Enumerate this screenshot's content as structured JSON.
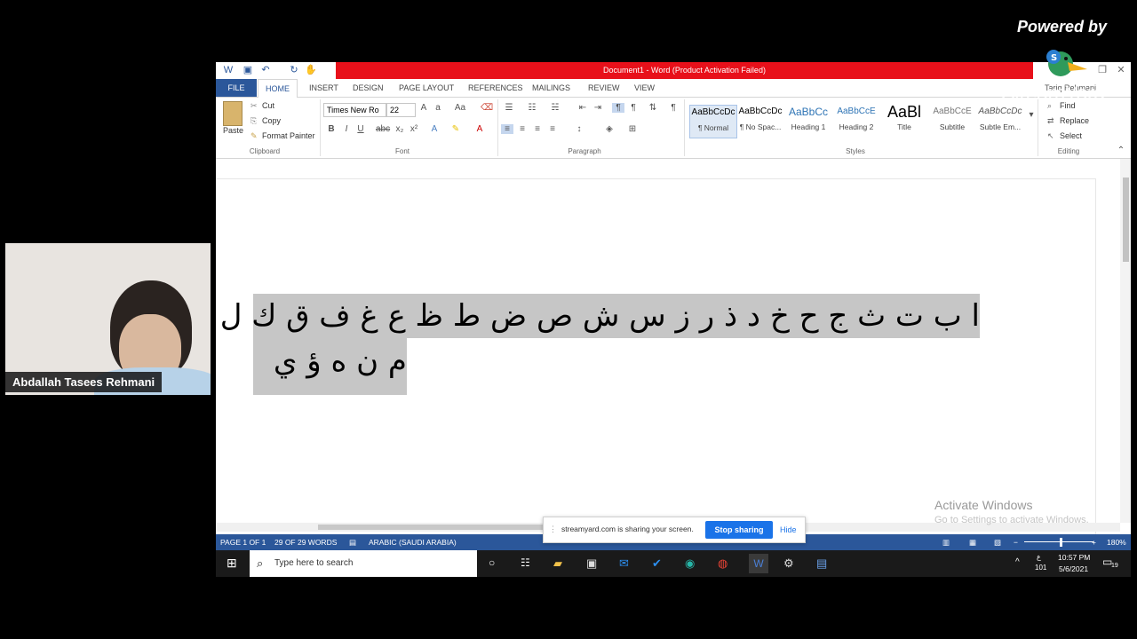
{
  "overlay": {
    "powered_by": "Powered by",
    "watermark": "StreamYard",
    "participant_name": "Abdallah Tasees Rehmani",
    "share_message": "streamyard.com is sharing your screen.",
    "stop_sharing": "Stop sharing",
    "hide": "Hide",
    "activate_title": "Activate Windows",
    "activate_sub": "Go to Settings to activate Windows."
  },
  "word": {
    "title": "Document1 - Word (Product Activation Failed)",
    "user": "Tariq Rehmani",
    "tabs": [
      "FILE",
      "HOME",
      "INSERT",
      "DESIGN",
      "PAGE LAYOUT",
      "REFERENCES",
      "MAILINGS",
      "REVIEW",
      "VIEW"
    ],
    "clipboard": {
      "paste": "Paste",
      "cut": "Cut",
      "copy": "Copy",
      "format_painter": "Format Painter",
      "label": "Clipboard"
    },
    "font": {
      "name": "Times New Ro",
      "size": "22",
      "label": "Font"
    },
    "paragraph_label": "Paragraph",
    "styles": [
      {
        "preview": "AaBbCcDc",
        "name": "¶ Normal"
      },
      {
        "preview": "AaBbCcDc",
        "name": "¶ No Spac..."
      },
      {
        "preview": "AaBbCc",
        "name": "Heading 1"
      },
      {
        "preview": "AaBbCcE",
        "name": "Heading 2"
      },
      {
        "preview": "AaBl",
        "name": "Title"
      },
      {
        "preview": "AaBbCcE",
        "name": "Subtitle"
      },
      {
        "preview": "AaBbCcDc",
        "name": "Subtle Em..."
      }
    ],
    "styles_label": "Styles",
    "editing": {
      "find": "Find",
      "replace": "Replace",
      "select": "Select",
      "label": "Editing"
    },
    "document_line1": "ا ب ت ث ج ح خ د ذ ر ز س ش ص ض ط ظ ع غ ف ق ك ل",
    "document_line2": "م ن ه ؤ ي",
    "status": {
      "page": "PAGE 1 OF 1",
      "words": "29 OF 29 WORDS",
      "language": "ARABIC (SAUDI ARABIA)",
      "zoom": "180%"
    }
  },
  "taskbar": {
    "search_placeholder": "Type here to search",
    "time": "10:57 PM",
    "date": "5/6/2021",
    "lang_top": "ع",
    "lang_bottom": "101",
    "notifications": "19"
  }
}
